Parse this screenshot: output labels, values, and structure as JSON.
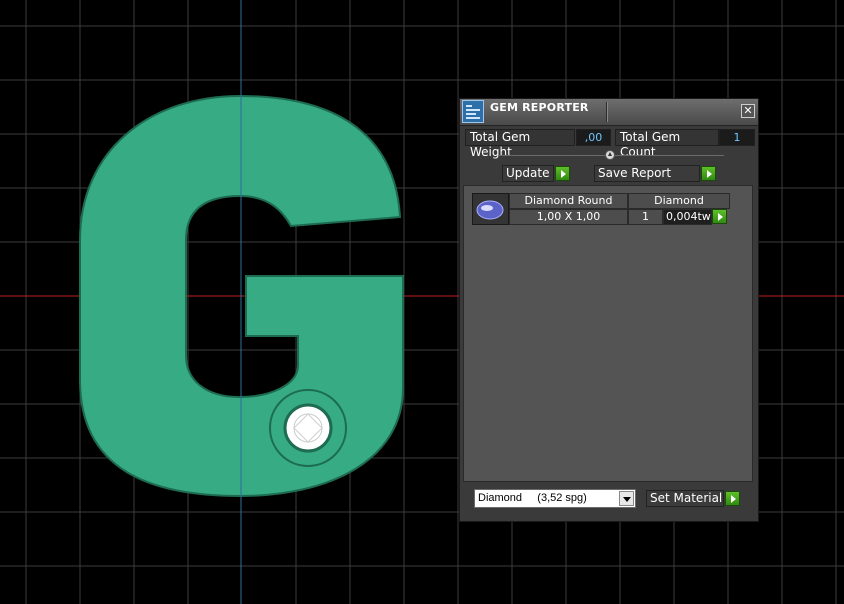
{
  "panel": {
    "title": "GEM REPORTER",
    "close_glyph": "✕",
    "total_gem_weight_label": "Total Gem Weight",
    "total_gem_weight_value": ",00",
    "total_gem_count_label": "Total Gem Count",
    "total_gem_count_value": "1",
    "update_label": "Update",
    "save_report_label": "Save Report",
    "gem_row": {
      "name": "Diamond Round",
      "material": "Diamond",
      "size": "1,00 X 1,00",
      "count": "1",
      "weight": "0,004tw"
    },
    "material_select": "Diamond     (3,52 spg)",
    "set_material_label": "Set Material"
  },
  "colors": {
    "letter_fill": "#36ab84",
    "letter_stroke": "#1d6b50",
    "grid": "#3d3d3d",
    "axis_x": "#c02020",
    "axis_y": "#2f6fa0",
    "accent_blue": "#6fc6ff",
    "green_button": "#4aa81f"
  },
  "icons": [
    "gem-reporter-logo-icon",
    "close-icon",
    "collapse-arrow-icon",
    "play-arrow-icon",
    "gem-thumbnail-icon",
    "chevron-down-icon"
  ]
}
